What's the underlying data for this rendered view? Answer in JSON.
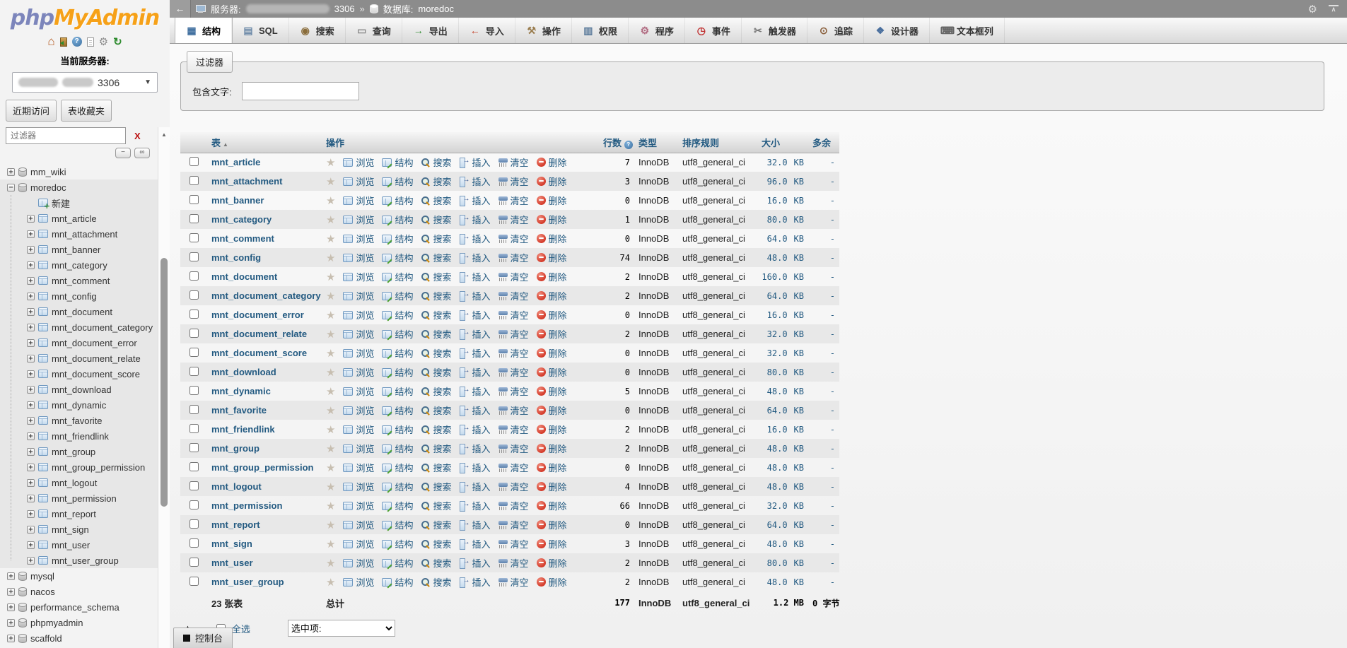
{
  "app": {
    "logo_part1": "php",
    "logo_part2": "MyAdmin"
  },
  "colors": {
    "link": "#235a81",
    "logo_orange": "#f6a118",
    "logo_blue": "#7c85bb",
    "drop_red": "#d43b2a",
    "topbar_gray": "#8c8c8c",
    "stripe_gray": "#e8e8e8"
  },
  "sidebar": {
    "header_icons": [
      "home-icon",
      "logout-icon",
      "help-icon",
      "docs-icon",
      "settings-icon",
      "refresh-icon"
    ],
    "current_server_label": "当前服务器:",
    "server_select_value": "3306",
    "buttons": [
      "近期访问",
      "表收藏夹"
    ],
    "filter_placeholder": "过滤器",
    "clear_filter_label": "X",
    "collapse_buttons": [
      "−",
      "∞"
    ],
    "tree": [
      {
        "label": "mm_wiki",
        "icon": "database-icon",
        "expander": "+"
      },
      {
        "label": "moredoc",
        "icon": "database-icon",
        "expander": "−",
        "active": true,
        "children": [
          {
            "label": "新建",
            "icon": "new-table-icon",
            "expander": ""
          },
          {
            "label": "mnt_article",
            "icon": "table-icon",
            "expander": "+"
          },
          {
            "label": "mnt_attachment",
            "icon": "table-icon",
            "expander": "+"
          },
          {
            "label": "mnt_banner",
            "icon": "table-icon",
            "expander": "+"
          },
          {
            "label": "mnt_category",
            "icon": "table-icon",
            "expander": "+"
          },
          {
            "label": "mnt_comment",
            "icon": "table-icon",
            "expander": "+"
          },
          {
            "label": "mnt_config",
            "icon": "table-icon",
            "expander": "+"
          },
          {
            "label": "mnt_document",
            "icon": "table-icon",
            "expander": "+"
          },
          {
            "label": "mnt_document_category",
            "icon": "table-icon",
            "expander": "+"
          },
          {
            "label": "mnt_document_error",
            "icon": "table-icon",
            "expander": "+"
          },
          {
            "label": "mnt_document_relate",
            "icon": "table-icon",
            "expander": "+"
          },
          {
            "label": "mnt_document_score",
            "icon": "table-icon",
            "expander": "+"
          },
          {
            "label": "mnt_download",
            "icon": "table-icon",
            "expander": "+"
          },
          {
            "label": "mnt_dynamic",
            "icon": "table-icon",
            "expander": "+"
          },
          {
            "label": "mnt_favorite",
            "icon": "table-icon",
            "expander": "+"
          },
          {
            "label": "mnt_friendlink",
            "icon": "table-icon",
            "expander": "+"
          },
          {
            "label": "mnt_group",
            "icon": "table-icon",
            "expander": "+"
          },
          {
            "label": "mnt_group_permission",
            "icon": "table-icon",
            "expander": "+"
          },
          {
            "label": "mnt_logout",
            "icon": "table-icon",
            "expander": "+"
          },
          {
            "label": "mnt_permission",
            "icon": "table-icon",
            "expander": "+"
          },
          {
            "label": "mnt_report",
            "icon": "table-icon",
            "expander": "+"
          },
          {
            "label": "mnt_sign",
            "icon": "table-icon",
            "expander": "+"
          },
          {
            "label": "mnt_user",
            "icon": "table-icon",
            "expander": "+"
          },
          {
            "label": "mnt_user_group",
            "icon": "table-icon",
            "expander": "+"
          }
        ]
      },
      {
        "label": "mysql",
        "icon": "database-icon",
        "expander": "+"
      },
      {
        "label": "nacos",
        "icon": "database-icon",
        "expander": "+"
      },
      {
        "label": "performance_schema",
        "icon": "database-icon",
        "expander": "+"
      },
      {
        "label": "phpmyadmin",
        "icon": "database-icon",
        "expander": "+"
      },
      {
        "label": "scaffold",
        "icon": "database-icon",
        "expander": "+"
      }
    ]
  },
  "topbar": {
    "server_label": "服务器:",
    "server_port": "3306",
    "separator": "»",
    "database_label": "数据库:",
    "database_name": "moredoc"
  },
  "tabs": [
    {
      "label": "结构",
      "icon": "structure-icon",
      "active": true
    },
    {
      "label": "SQL",
      "icon": "sql-icon"
    },
    {
      "label": "搜索",
      "icon": "search-icon"
    },
    {
      "label": "查询",
      "icon": "query-icon"
    },
    {
      "label": "导出",
      "icon": "export-icon"
    },
    {
      "label": "导入",
      "icon": "import-icon"
    },
    {
      "label": "操作",
      "icon": "operations-icon"
    },
    {
      "label": "权限",
      "icon": "privileges-icon"
    },
    {
      "label": "程序",
      "icon": "routines-icon"
    },
    {
      "label": "事件",
      "icon": "events-icon"
    },
    {
      "label": "触发器",
      "icon": "triggers-icon"
    },
    {
      "label": "追踪",
      "icon": "tracking-icon"
    },
    {
      "label": "设计器",
      "icon": "designer-icon"
    },
    {
      "label": "文本框列",
      "icon": "central-columns-icon"
    }
  ],
  "filter_panel": {
    "legend": "过滤器",
    "label": "包含文字:"
  },
  "table": {
    "headers": {
      "name": "表",
      "actions": "操作",
      "rows": "行数",
      "type": "类型",
      "collation": "排序规则",
      "size": "大小",
      "overhead": "多余"
    },
    "actions": [
      {
        "label": "浏览",
        "icon": "browse-icon"
      },
      {
        "label": "结构",
        "icon": "structure-action-icon"
      },
      {
        "label": "搜索",
        "icon": "search-action-icon"
      },
      {
        "label": "插入",
        "icon": "insert-icon"
      },
      {
        "label": "清空",
        "icon": "empty-icon"
      },
      {
        "label": "删除",
        "icon": "drop-icon"
      }
    ],
    "size_unit": "KB",
    "rows": [
      {
        "name": "mnt_article",
        "rows": "7",
        "type": "InnoDB",
        "collation": "utf8_general_ci",
        "size": "32.0",
        "overhead": "-"
      },
      {
        "name": "mnt_attachment",
        "rows": "3",
        "type": "InnoDB",
        "collation": "utf8_general_ci",
        "size": "96.0",
        "overhead": "-"
      },
      {
        "name": "mnt_banner",
        "rows": "0",
        "type": "InnoDB",
        "collation": "utf8_general_ci",
        "size": "16.0",
        "overhead": "-"
      },
      {
        "name": "mnt_category",
        "rows": "1",
        "type": "InnoDB",
        "collation": "utf8_general_ci",
        "size": "80.0",
        "overhead": "-"
      },
      {
        "name": "mnt_comment",
        "rows": "0",
        "type": "InnoDB",
        "collation": "utf8_general_ci",
        "size": "64.0",
        "overhead": "-"
      },
      {
        "name": "mnt_config",
        "rows": "74",
        "type": "InnoDB",
        "collation": "utf8_general_ci",
        "size": "48.0",
        "overhead": "-"
      },
      {
        "name": "mnt_document",
        "rows": "2",
        "type": "InnoDB",
        "collation": "utf8_general_ci",
        "size": "160.0",
        "overhead": "-"
      },
      {
        "name": "mnt_document_category",
        "rows": "2",
        "type": "InnoDB",
        "collation": "utf8_general_ci",
        "size": "64.0",
        "overhead": "-"
      },
      {
        "name": "mnt_document_error",
        "rows": "0",
        "type": "InnoDB",
        "collation": "utf8_general_ci",
        "size": "16.0",
        "overhead": "-"
      },
      {
        "name": "mnt_document_relate",
        "rows": "2",
        "type": "InnoDB",
        "collation": "utf8_general_ci",
        "size": "32.0",
        "overhead": "-"
      },
      {
        "name": "mnt_document_score",
        "rows": "0",
        "type": "InnoDB",
        "collation": "utf8_general_ci",
        "size": "32.0",
        "overhead": "-"
      },
      {
        "name": "mnt_download",
        "rows": "0",
        "type": "InnoDB",
        "collation": "utf8_general_ci",
        "size": "80.0",
        "overhead": "-"
      },
      {
        "name": "mnt_dynamic",
        "rows": "5",
        "type": "InnoDB",
        "collation": "utf8_general_ci",
        "size": "48.0",
        "overhead": "-"
      },
      {
        "name": "mnt_favorite",
        "rows": "0",
        "type": "InnoDB",
        "collation": "utf8_general_ci",
        "size": "64.0",
        "overhead": "-"
      },
      {
        "name": "mnt_friendlink",
        "rows": "2",
        "type": "InnoDB",
        "collation": "utf8_general_ci",
        "size": "16.0",
        "overhead": "-"
      },
      {
        "name": "mnt_group",
        "rows": "2",
        "type": "InnoDB",
        "collation": "utf8_general_ci",
        "size": "48.0",
        "overhead": "-"
      },
      {
        "name": "mnt_group_permission",
        "rows": "0",
        "type": "InnoDB",
        "collation": "utf8_general_ci",
        "size": "48.0",
        "overhead": "-"
      },
      {
        "name": "mnt_logout",
        "rows": "4",
        "type": "InnoDB",
        "collation": "utf8_general_ci",
        "size": "48.0",
        "overhead": "-"
      },
      {
        "name": "mnt_permission",
        "rows": "66",
        "type": "InnoDB",
        "collation": "utf8_general_ci",
        "size": "32.0",
        "overhead": "-"
      },
      {
        "name": "mnt_report",
        "rows": "0",
        "type": "InnoDB",
        "collation": "utf8_general_ci",
        "size": "64.0",
        "overhead": "-"
      },
      {
        "name": "mnt_sign",
        "rows": "3",
        "type": "InnoDB",
        "collation": "utf8_general_ci",
        "size": "48.0",
        "overhead": "-"
      },
      {
        "name": "mnt_user",
        "rows": "2",
        "type": "InnoDB",
        "collation": "utf8_general_ci",
        "size": "80.0",
        "overhead": "-"
      },
      {
        "name": "mnt_user_group",
        "rows": "2",
        "type": "InnoDB",
        "collation": "utf8_general_ci",
        "size": "48.0",
        "overhead": "-"
      }
    ],
    "summary": {
      "tables": "23 张表",
      "total": "总计",
      "rows": "177",
      "type": "InnoDB",
      "collation": "utf8_general_ci",
      "size": "1.2 MB",
      "overhead": "0 字节"
    }
  },
  "controls": {
    "check_all": "全选",
    "with_selected_label": "选中项:"
  },
  "console": {
    "label": "控制台"
  }
}
